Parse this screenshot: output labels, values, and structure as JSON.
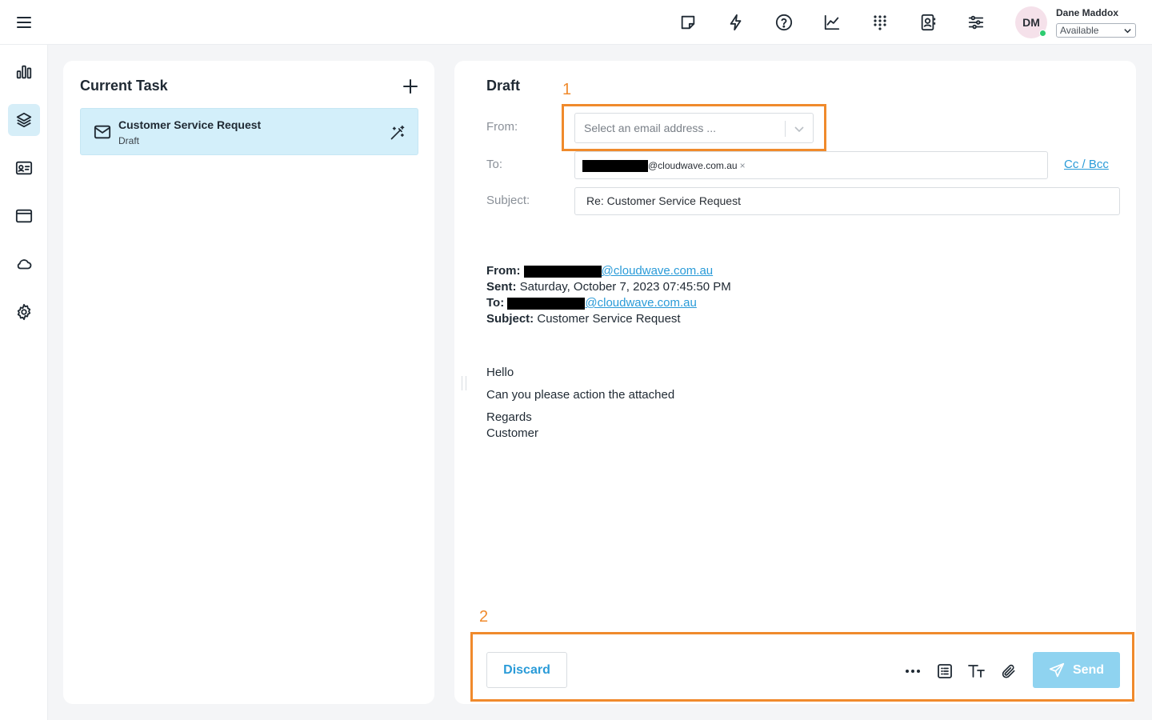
{
  "header": {
    "user": {
      "initials": "DM",
      "name": "Dane Maddox",
      "status": "Available"
    },
    "icons": [
      "sticky-note-icon",
      "lightning-icon",
      "help-icon",
      "analytics-icon",
      "dialpad-icon",
      "contacts-icon",
      "settings-sliders-icon"
    ]
  },
  "sidebar": {
    "items": [
      "dashboard-icon",
      "layers-icon",
      "contact-card-icon",
      "window-icon",
      "cloud-icon",
      "gear-icon"
    ],
    "active_index": 1
  },
  "tasks": {
    "title": "Current Task",
    "items": [
      {
        "title": "Customer Service Request",
        "status": "Draft"
      }
    ]
  },
  "draft": {
    "title": "Draft",
    "from_label": "From:",
    "from_placeholder": "Select an email address ...",
    "to_label": "To:",
    "to_recipient_domain": "@cloudwave.com.au",
    "to_remove": "×",
    "cc_bcc": "Cc / Bcc",
    "subject_label": "Subject:",
    "subject_value": "Re: Customer Service Request",
    "quoted": {
      "from_label": "From:",
      "from_domain": "@cloudwave.com.au",
      "sent_label": "Sent:",
      "sent_value": "Saturday, October 7, 2023 07:45:50 PM",
      "to_label": "To:",
      "to_domain": "@cloudwave.com.au",
      "subject_label": "Subject:",
      "subject_value": "Customer Service Request"
    },
    "body": {
      "greeting": "Hello",
      "line1": "Can you please action the attached",
      "signoff": "Regards",
      "name": "Customer"
    },
    "footer": {
      "discard": "Discard",
      "send": "Send",
      "tools": [
        "more-options-icon",
        "template-icon",
        "text-format-icon",
        "attachment-icon"
      ]
    }
  },
  "annotations": {
    "callout1": "1",
    "callout2": "2"
  },
  "colors": {
    "accent": "#2a9bd8",
    "send_button": "#8fd3f0",
    "active_bg": "#d3effa",
    "callout": "#f08a2c",
    "status_online": "#2ecc71"
  }
}
